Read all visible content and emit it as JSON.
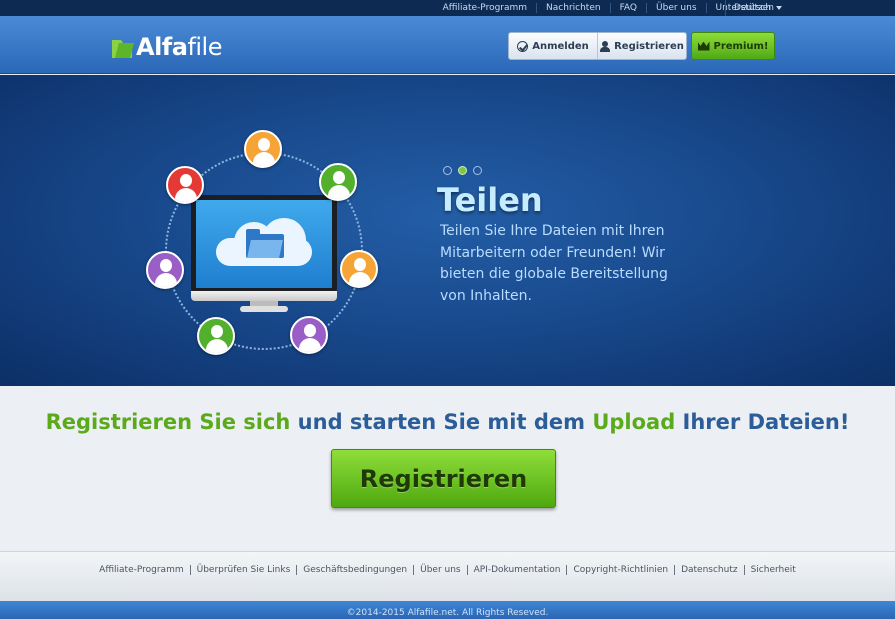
{
  "topnav": {
    "links": [
      "Affiliate-Programm",
      "Nachrichten",
      "FAQ",
      "Über uns",
      "Unterstützen"
    ],
    "language": "Deutsch"
  },
  "header": {
    "logo_bold": "Alfa",
    "logo_light": "file",
    "login_label": "Anmelden",
    "register_label": "Registrieren",
    "premium_label": "Premium!"
  },
  "hero": {
    "title": "Teilen",
    "text": "Teilen Sie Ihre Dateien mit Ihren Mitarbeitern oder Freunden! Wir bieten die globale Bereitstellung von Inhalten.",
    "slide_count": 3,
    "active_slide": 2
  },
  "cta": {
    "part1": "Registrieren Sie sich",
    "part2": " und starten Sie mit dem ",
    "part3": "Upload",
    "part4": " Ihrer Dateien!",
    "button_label": "Registrieren"
  },
  "footer": {
    "links": [
      "Affiliate-Programm",
      "Überprüfen Sie Links",
      "Geschäftsbedingungen",
      "Über uns",
      "API-Dokumentation",
      "Copyright-Richtlinien",
      "Datenschutz",
      "Sicherheit"
    ],
    "copyright": "©2014-2015 Alfafile.net. All Rights Reseved."
  },
  "colors": {
    "brand_blue": "#2b68b8",
    "accent_green": "#5aaa1c",
    "hero_dark": "#0c2f66"
  }
}
